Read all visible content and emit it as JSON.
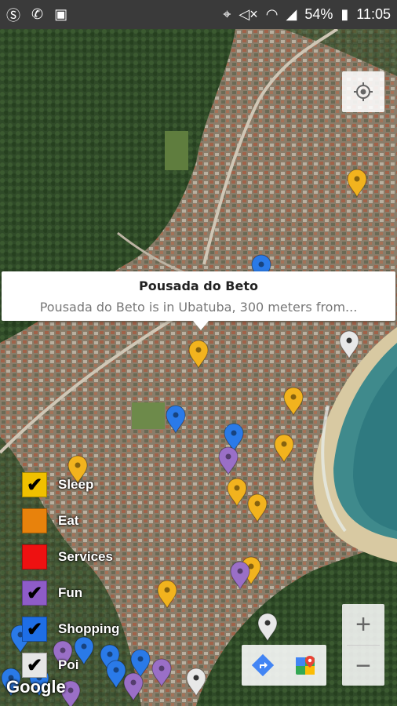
{
  "status_bar": {
    "left_icons": [
      "skype-icon",
      "whatsapp-icon",
      "gallery-icon"
    ],
    "battery": "54%",
    "time": "11:05"
  },
  "info_window": {
    "title": "Pousada do Beto",
    "snippet": "Pousada do Beto is in Ubatuba, 300 meters from..."
  },
  "legend": {
    "items": [
      {
        "label": "Sleep",
        "color": "#f0c000",
        "checked": true
      },
      {
        "label": "Eat",
        "color": "#e8820c",
        "checked": false
      },
      {
        "label": "Services",
        "color": "#ee1111",
        "checked": false
      },
      {
        "label": "Fun",
        "color": "#8e5cc8",
        "checked": true
      },
      {
        "label": "Shopping",
        "color": "#1e6ee6",
        "checked": true
      },
      {
        "label": "Poi",
        "color": "#e6e6e6",
        "checked": true
      }
    ]
  },
  "zoom": {
    "in_label": "+",
    "out_label": "−"
  },
  "attribution": "Google",
  "colors": {
    "sleep_marker": "#f2b31e",
    "fun_marker": "#9a6fc7",
    "shopping_marker": "#2a7ae8",
    "poi_marker": "#e8e8e8"
  }
}
